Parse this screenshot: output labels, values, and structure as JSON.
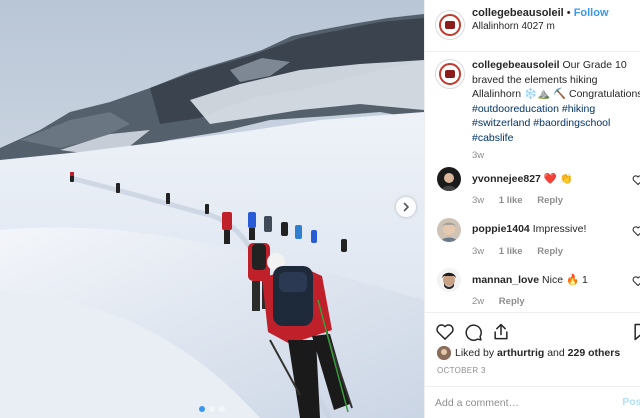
{
  "header": {
    "username": "collegebeausoleil",
    "separator": "•",
    "follow_label": "Follow",
    "location": "Allalinhorn 4027 m"
  },
  "caption": {
    "username": "collegebeausoleil",
    "text": "Our Grade 10 braved the elements hiking Allalinhorn ❄️⛰️ ⛏️ Congratulations!",
    "hashtags": [
      "#outdooreducation #hiking",
      "#switzerland #baordingschool",
      "#cabslife"
    ],
    "time": "3w"
  },
  "comments": [
    {
      "username": "yvonnejee827",
      "text": "❤️ 👏",
      "time": "3w",
      "likes": "1 like",
      "reply": "Reply"
    },
    {
      "username": "poppie1404",
      "text": "Impressive!",
      "time": "3w",
      "likes": "1 like",
      "reply": "Reply"
    },
    {
      "username": "mannan_love",
      "text": "Nice 🔥 1",
      "time": "2w",
      "reply": "Reply"
    }
  ],
  "likes": {
    "prefix": "Liked by",
    "user": "arthurtrig",
    "joiner": "and",
    "others": "229 others"
  },
  "date": "OCTOBER 3",
  "add_comment": {
    "placeholder": "Add a comment…",
    "post_label": "Post"
  },
  "carousel": {
    "slides": 3,
    "active": 0
  },
  "colors": {
    "link": "#3897f0",
    "hashtag": "#003569",
    "muted": "#8e8e8e",
    "jacket": "#c0202a"
  }
}
